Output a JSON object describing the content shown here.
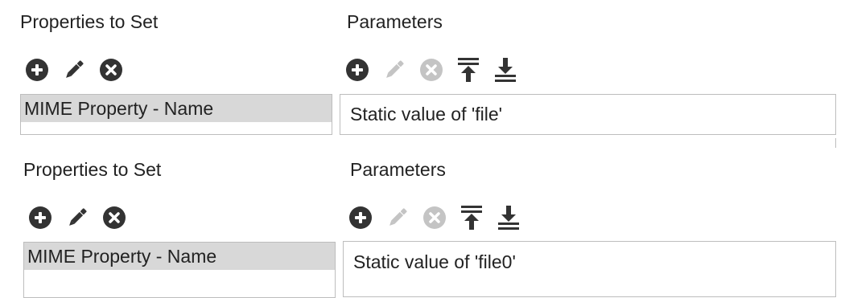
{
  "colors": {
    "icon_active": "#333333",
    "icon_disabled": "#c4c4c4",
    "list_border": "#bdbdbd",
    "selected_row": "#d8d8d8"
  },
  "panels": [
    {
      "properties_heading": "Properties to Set",
      "parameters_heading": "Parameters",
      "properties_toolbar": [
        "add-icon",
        "edit-icon",
        "remove-icon"
      ],
      "parameters_toolbar": [
        "add-icon",
        "edit-icon (disabled)",
        "remove-icon (disabled)",
        "move-to-top-icon",
        "move-to-bottom-icon"
      ],
      "properties": [
        {
          "label": "MIME Property - Name",
          "selected": true
        }
      ],
      "parameter_value": "Static value of 'file'"
    },
    {
      "properties_heading": "Properties to Set",
      "parameters_heading": "Parameters",
      "properties_toolbar": [
        "add-icon",
        "edit-icon",
        "remove-icon"
      ],
      "parameters_toolbar": [
        "add-icon",
        "edit-icon (disabled)",
        "remove-icon (disabled)",
        "move-to-top-icon",
        "move-to-bottom-icon"
      ],
      "properties": [
        {
          "label": "MIME Property - Name",
          "selected": true
        }
      ],
      "parameter_value": "Static value of 'file0'"
    }
  ]
}
